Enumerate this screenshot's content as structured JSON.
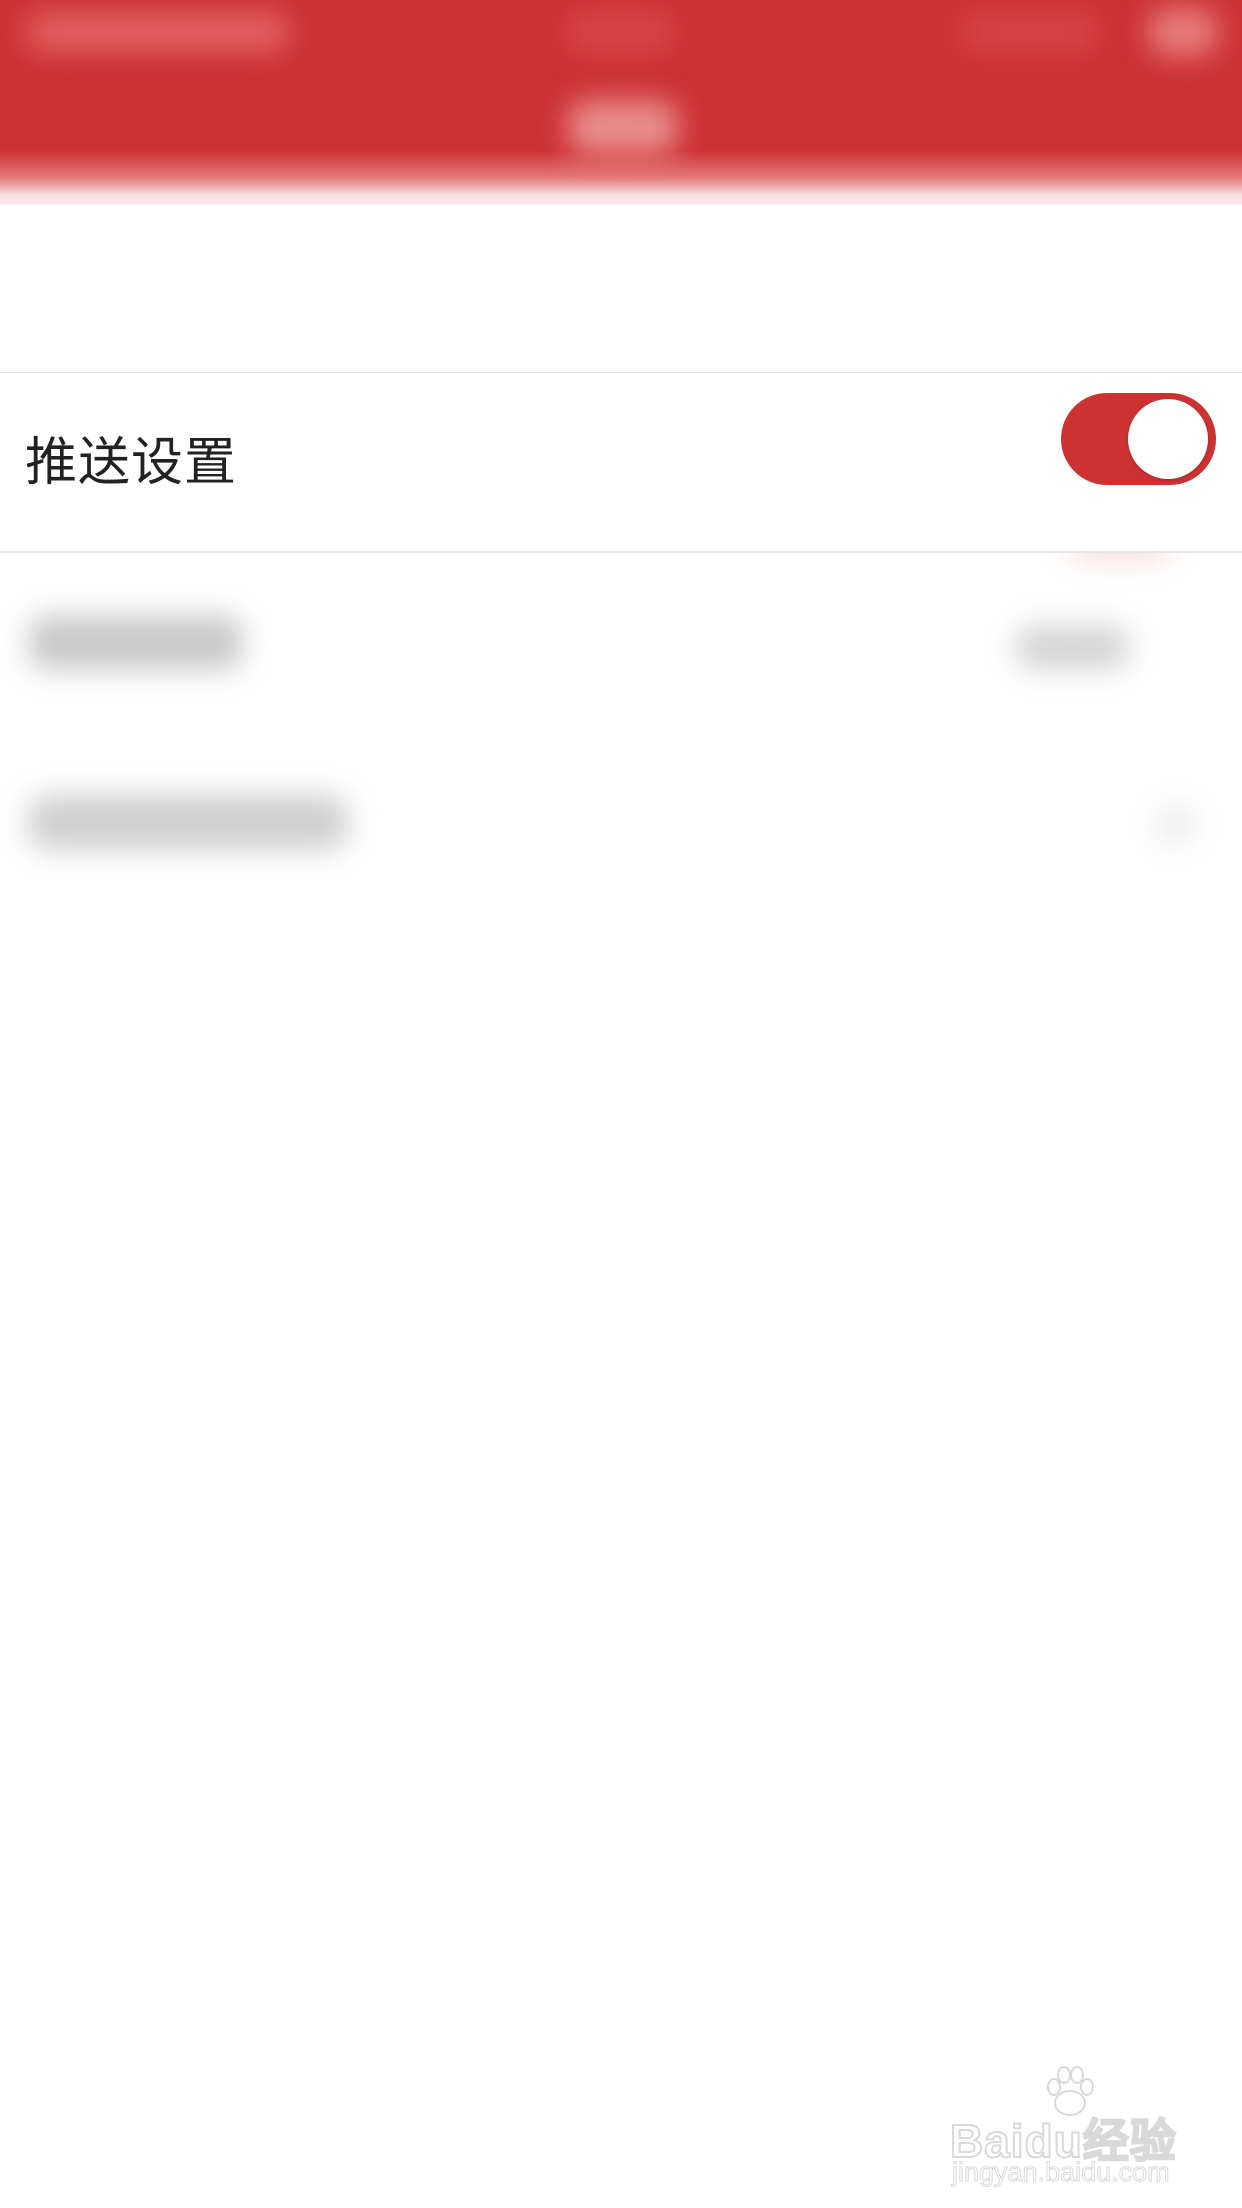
{
  "theme": {
    "accent": "#cd3233",
    "background": "#ffffff",
    "divider": "#e6e6e6",
    "text": "#222222"
  },
  "settings": {
    "push": {
      "label": "推送设置",
      "toggle_on": true
    }
  },
  "watermark": {
    "brand": "Baidu经验",
    "url": "jingyan.baidu.com",
    "icon": "paw-icon"
  }
}
